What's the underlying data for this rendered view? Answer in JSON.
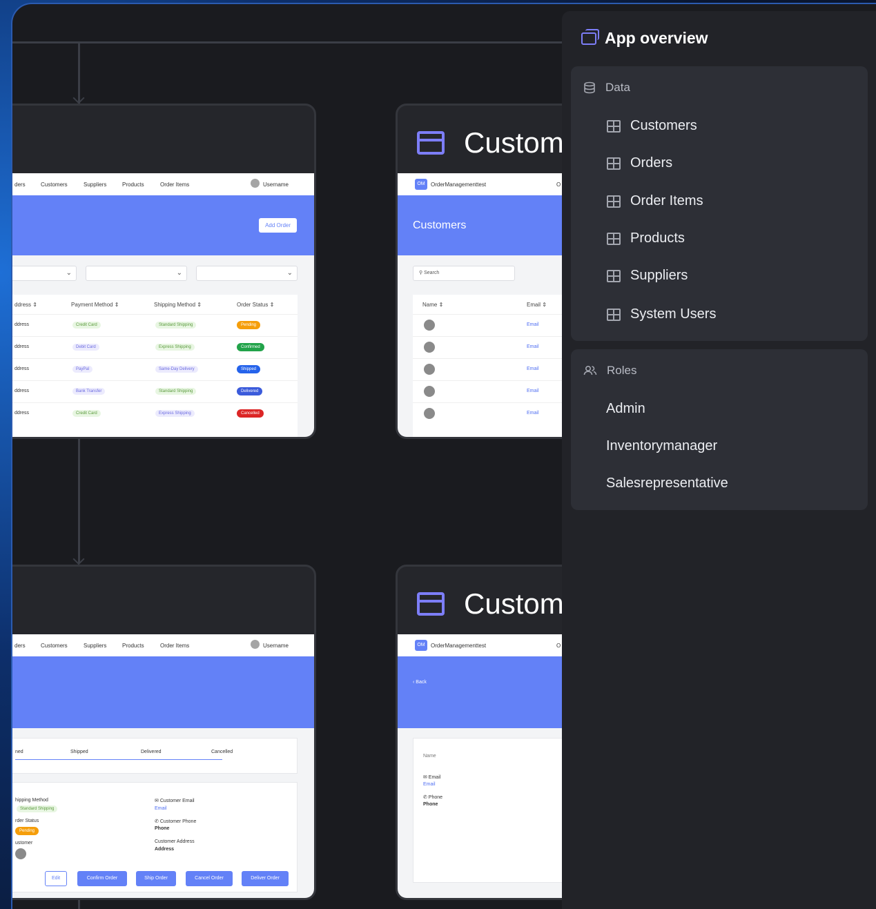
{
  "canvas": {
    "top_left_card": {
      "nav": [
        "ders",
        "Customers",
        "Suppliers",
        "Products",
        "Order Items"
      ],
      "username": "Username",
      "add_button": "Add Order",
      "columns": [
        "ddress ⇕",
        "Payment Method ⇕",
        "Shipping Method ⇕",
        "Order Status ⇕"
      ],
      "rows": [
        {
          "addr": "ddress",
          "payment": "Credit Card",
          "shipping": "Standard Shipping",
          "status": "Pending",
          "status_color": "#f59e0b"
        },
        {
          "addr": "ddress",
          "payment": "Debit Card",
          "shipping": "Express Shipping",
          "status": "Confirmed",
          "status_color": "#22a34a"
        },
        {
          "addr": "ddress",
          "payment": "PayPal",
          "shipping": "Same-Day Delivery",
          "status": "Shipped",
          "status_color": "#2563eb"
        },
        {
          "addr": "ddress",
          "payment": "Bank Transfer",
          "shipping": "Standard Shipping",
          "status": "Delivered",
          "status_color": "#3b5bdb"
        },
        {
          "addr": "ddress",
          "payment": "Credit Card",
          "shipping": "Express Shipping",
          "status": "Cancelled",
          "status_color": "#dc2626"
        }
      ]
    },
    "top_right_card": {
      "title": "Custom",
      "app_logo": "OM",
      "app_name": "OrderManagementtest",
      "nav_stub": "O",
      "hero_title": "Customers",
      "search_placeholder": "Search",
      "columns": [
        "Name ⇕",
        "Email ⇕"
      ],
      "email_link": "Email"
    },
    "bottom_left_card": {
      "nav": [
        "ders",
        "Customers",
        "Suppliers",
        "Products",
        "Order Items"
      ],
      "username": "Username",
      "steps": [
        "ned",
        "Shipped",
        "Delivered",
        "Cancelled"
      ],
      "shipping_label": "hipping Method",
      "shipping_value": "Standard Shipping",
      "status_label": "rder Status",
      "status_value": "Pending",
      "customer_label": "ustomer",
      "email_label": "Customer Email",
      "email_value": "Email",
      "phone_label": "Customer Phone",
      "phone_value": "Phone",
      "address_label": "Customer Address",
      "address_value": "Address",
      "buttons": [
        "Edit",
        "Confirm Order",
        "Ship Order",
        "Cancel Order",
        "Deliver Order"
      ]
    },
    "bottom_right_card": {
      "title": "Custom",
      "app_logo": "OM",
      "app_name": "OrderManagementtest",
      "nav_stub": "O",
      "back": "‹ Back",
      "name_label": "Name",
      "email_label": "✉ Email",
      "email_value": "Email",
      "phone_label": "✆ Phone",
      "phone_value": "Phone"
    }
  },
  "sidebar": {
    "title": "App overview",
    "data_group": {
      "label": "Data",
      "items": [
        "Customers",
        "Orders",
        "Order Items",
        "Products",
        "Suppliers",
        "System Users"
      ]
    },
    "roles_group": {
      "label": "Roles",
      "items": [
        "Admin",
        "Inventorymanager",
        "Salesrepresentative"
      ]
    }
  }
}
